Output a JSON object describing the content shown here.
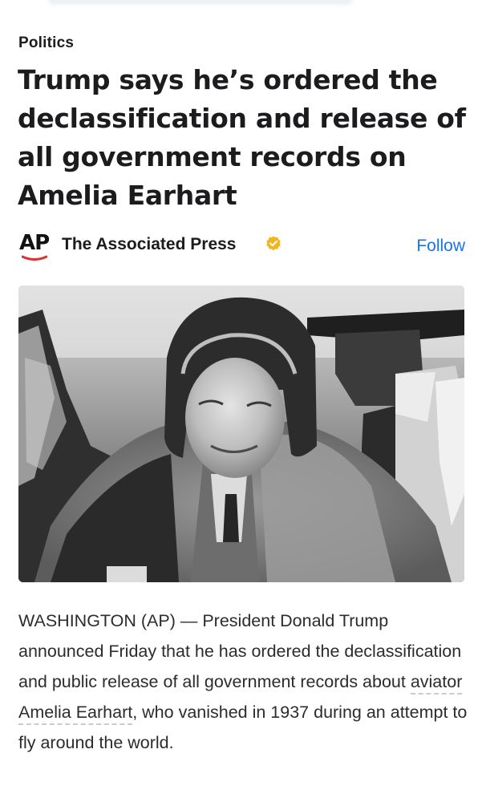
{
  "article": {
    "category": "Politics",
    "headline": "Trump says he’s ordered the declassification and release of all government records on Amelia Earhart",
    "source": {
      "logo_text": "AP",
      "name": "The Associated Press",
      "verified_icon": "verified-badge-icon",
      "follow_label": "Follow"
    },
    "image": {
      "icon": "photo-amelia-earhart"
    },
    "body": {
      "part1": "WASHINGTON (AP) — President Donald Trump announced Friday that he has ordered the declassification and public release of all government records about ",
      "link_text": "aviator Amelia Earhart",
      "part2": ", who vanished in 1937 during an attempt to fly around the world."
    }
  },
  "colors": {
    "follow": "#1a73e8",
    "ap_underline": "#e0312f",
    "verified_badge": "#f2b51d",
    "link_underline": "#c7ccd3"
  }
}
